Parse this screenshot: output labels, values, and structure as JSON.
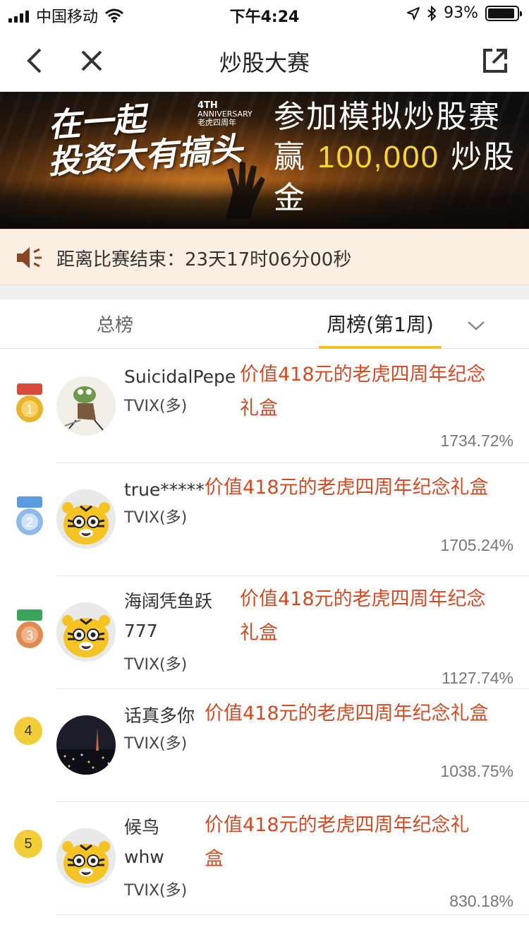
{
  "status_bar": {
    "carrier": "中国移动",
    "time": "下午4:24",
    "battery": "93%",
    "battery_level": 0.93,
    "icons": [
      "signal-icon",
      "wifi-icon",
      "location-arrow-icon",
      "bluetooth-icon",
      "battery-icon"
    ]
  },
  "nav": {
    "title": "炒股大赛",
    "icons": [
      "back-chevron-icon",
      "close-icon",
      "share-icon"
    ]
  },
  "banner": {
    "slogan_line1": "在一起",
    "slogan_line2": "投资大有搞头",
    "anniv_big": "4TH",
    "anniv_small": "ANNIVERSARY",
    "anniv_cn": "老虎四周年",
    "line1": "参加模拟炒股赛",
    "line2_prefix": "赢",
    "amount": "100,000",
    "line2_suffix": "炒股金",
    "amount_color": "#f5d531"
  },
  "countdown": {
    "text": "距离比赛结束：23天17时06分00秒",
    "icon": "speaker-icon"
  },
  "tabs": {
    "total": "总榜",
    "weekly": "周榜(第1周)",
    "active": "weekly",
    "accent": "#f0c228",
    "dropdown_icon": "chevron-down-icon"
  },
  "colors": {
    "prize": "#d64a22",
    "gold": "#e8b42c",
    "silver": "#8fb9ea",
    "bronze": "#e08a52",
    "rank_badge": "#f2cd3a"
  },
  "rows": [
    {
      "rank": "1",
      "badge": "gold-medal-icon",
      "avatar": "pepe-avatar",
      "name_lines": [
        "SuicidalPepe"
      ],
      "position": "TVIX(多)",
      "prize_lines": [
        "价值418元的老虎四周年纪念",
        "礼盒"
      ],
      "pct": "1734.72%"
    },
    {
      "rank": "2",
      "badge": "silver-medal-icon",
      "avatar": "tiger-avatar",
      "name_lines": [
        "true*****"
      ],
      "position": "TVIX(多)",
      "prize_lines": [
        "价值418元的老虎四周年纪念礼盒"
      ],
      "pct": "1705.24%"
    },
    {
      "rank": "3",
      "badge": "bronze-medal-icon",
      "avatar": "tiger-avatar",
      "name_lines": [
        "海阔凭鱼跃",
        "777"
      ],
      "position": "TVIX(多)",
      "prize_lines": [
        "价值418元的老虎四周年纪念",
        "礼盒"
      ],
      "pct": "1127.74%"
    },
    {
      "rank": "4",
      "badge": "rank-circle",
      "avatar": "night-city-avatar",
      "name_lines": [
        "话真多你"
      ],
      "position": "TVIX(多)",
      "prize_lines": [
        "价值418元的老虎四周年纪念礼盒"
      ],
      "pct": "1038.75%"
    },
    {
      "rank": "5",
      "badge": "rank-circle",
      "avatar": "tiger-avatar",
      "name_lines": [
        "候鸟",
        "whw"
      ],
      "position": "TVIX(多)",
      "prize_lines": [
        "价值418元的老虎四周年纪念礼",
        "盒"
      ],
      "pct": "830.18%"
    }
  ]
}
